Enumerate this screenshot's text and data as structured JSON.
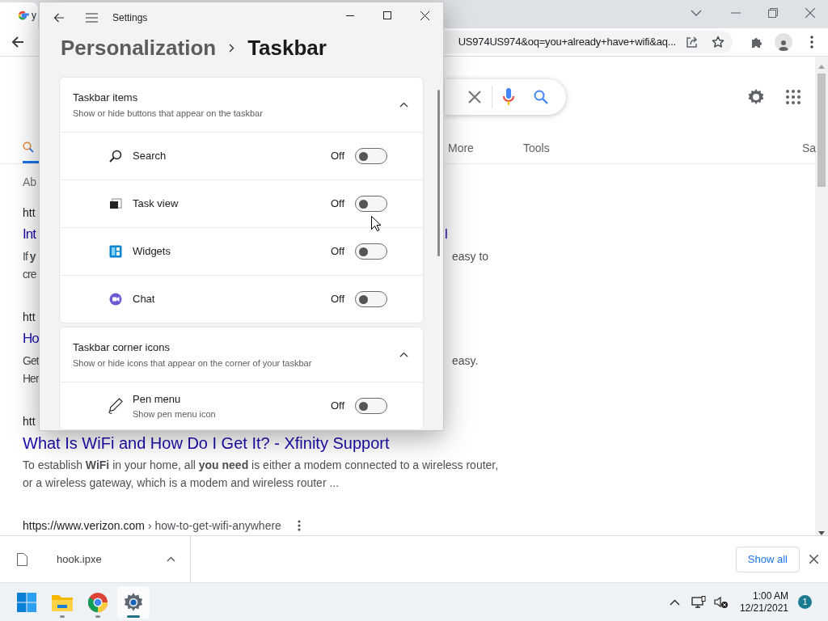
{
  "browser": {
    "tab_title": "y",
    "address": "US974US974&oq=you+already+have+wifi&aq...",
    "search_tabs": [
      {
        "label": "More"
      },
      {
        "label": "Tools"
      },
      {
        "label": "Sa"
      }
    ],
    "results": [
      {
        "kind": "about",
        "text": "Ab"
      },
      {
        "kind": "url",
        "text": "htt"
      },
      {
        "kind": "title",
        "text": "Int",
        "right": "l"
      },
      {
        "kind": "text",
        "text": "If **y**",
        "right": "easy to"
      },
      {
        "kind": "text",
        "text": "cre"
      },
      {
        "kind": "url",
        "text": "htt"
      },
      {
        "kind": "title",
        "text": "Ho"
      },
      {
        "kind": "text",
        "text": "Get",
        "right": "easy."
      },
      {
        "kind": "text",
        "text": "Her"
      },
      {
        "kind": "url",
        "text": "htt"
      },
      {
        "kind": "title",
        "text": "What Is WiFi and How Do I Get It? - Xfinity Support"
      },
      {
        "kind": "text",
        "text": "To establish **WiFi** in your home, all **you need** is either a modem connected to a wireless router, or a wireless gateway, which is a modem and wireless router ..."
      },
      {
        "kind": "url",
        "text": "https://www.verizon.com",
        "path": "› how-to-get-wifi-anywhere"
      }
    ],
    "download": {
      "file": "hook.ipxe",
      "button": "Show all"
    }
  },
  "settings": {
    "title": "Settings",
    "breadcrumb": {
      "parent": "Personalization",
      "current": "Taskbar"
    },
    "sections": [
      {
        "title": "Taskbar items",
        "subtitle": "Show or hide buttons that appear on the taskbar",
        "expanded": true,
        "items": [
          {
            "kind": "search",
            "label": "Search",
            "state_text": "Off",
            "on": false
          },
          {
            "kind": "taskview",
            "label": "Task view",
            "state_text": "Off",
            "on": false
          },
          {
            "kind": "widgets",
            "label": "Widgets",
            "state_text": "Off",
            "on": false
          },
          {
            "kind": "chat",
            "label": "Chat",
            "state_text": "Off",
            "on": false
          }
        ]
      },
      {
        "title": "Taskbar corner icons",
        "subtitle": "Show or hide icons that appear on the corner of your taskbar",
        "expanded": true,
        "items": [
          {
            "kind": "pen",
            "label": "Pen menu",
            "subtitle": "Show pen menu icon",
            "state_text": "Off",
            "on": false
          }
        ]
      }
    ]
  },
  "taskbar": {
    "apps": [
      {
        "kind": "start",
        "active": false
      },
      {
        "kind": "explorer",
        "active": false
      },
      {
        "kind": "chrome",
        "active": false
      },
      {
        "kind": "settings",
        "active": true
      }
    ],
    "time": "1:00 AM",
    "date": "12/21/2021",
    "badge": "1"
  }
}
